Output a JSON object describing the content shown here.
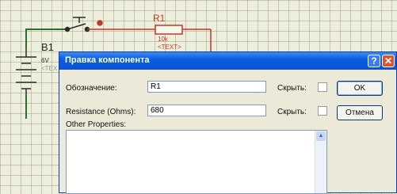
{
  "schematic": {
    "resistor_ref": "R1",
    "resistor_value": "10k",
    "resistor_text": "<TEXT>",
    "battery_ref": "B1",
    "battery_value": "6V",
    "battery_text": "<TEX"
  },
  "dialog": {
    "title": "Правка компонента",
    "help_glyph": "?",
    "close_glyph": "✕",
    "fields": [
      {
        "label": "Обозначение:",
        "value": "R1",
        "hide_label": "Скрыть:"
      },
      {
        "label": "Resistance (Ohms):",
        "value": "680",
        "hide_label": "Скрыть:"
      }
    ],
    "other_properties_label": "Other Properties:",
    "ok_label": "OK",
    "cancel_label": "Отмена"
  },
  "colors": {
    "title_bar": "#0b54d2",
    "dialog_bg": "#ece9d8",
    "wire": "#1a5f1a",
    "component": "#c0392b"
  }
}
